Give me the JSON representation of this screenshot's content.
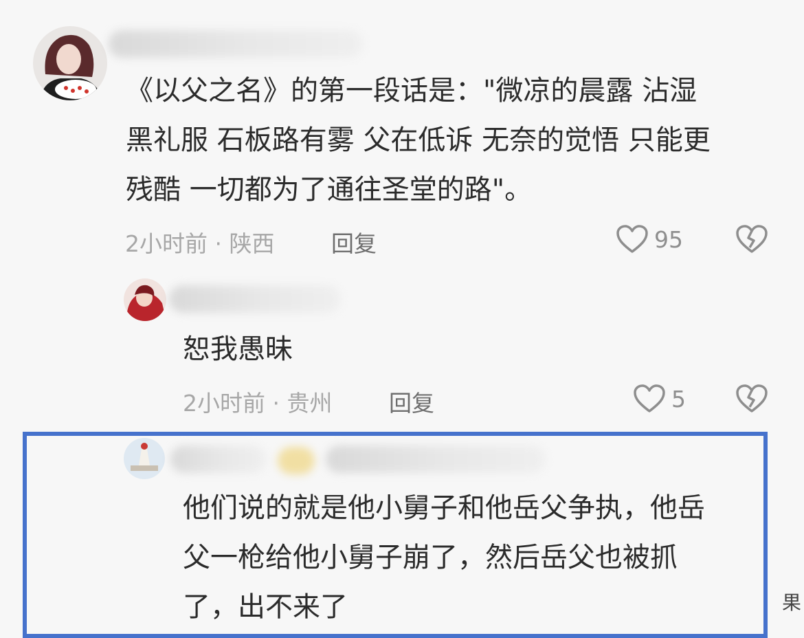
{
  "comments": [
    {
      "text": "《以父之名》的第一段话是：\"微凉的晨露 沾湿\n黑礼服 石板路有雾 父在低诉 无奈的觉悟 只能更\n残酷 一切都为了通往圣堂的路\"。",
      "meta": "2小时前 · 陕西",
      "reply_label": "回复",
      "likes": "95"
    },
    {
      "text": "恕我愚昧",
      "meta": "2小时前 · 贵州",
      "reply_label": "回复",
      "likes": "5"
    },
    {
      "text": "他们说的就是他小舅子和他岳父争执，他岳\n父一枪给他小舅子崩了，然后岳父也被抓\n了，出不来了"
    }
  ],
  "edge_glyph": "果",
  "colors": {
    "highlight_border": "#4672cc",
    "meta_text": "#a7a7a7",
    "body_text": "#2b2b2b"
  },
  "icons": {
    "like": "heart-outline-icon",
    "dislike": "broken-heart-icon"
  }
}
